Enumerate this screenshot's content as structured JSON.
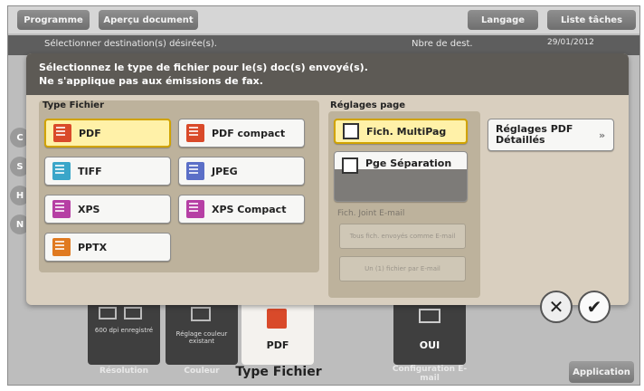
{
  "topbar": {
    "programme": "Programme",
    "apercu": "Aperçu document",
    "langage": "Langage",
    "liste_taches": "Liste tâches"
  },
  "destbar": {
    "text": "Sélectionner destination(s) désirée(s).",
    "nbre": "Nbre de dest.",
    "date": "29/01/2012"
  },
  "side_tabs": [
    "C",
    "S",
    "H",
    "N"
  ],
  "dialog": {
    "line1": "Sélectionnez le type de fichier pour le(s) doc(s) envoyé(s).",
    "line2": "Ne s'applique pas aux émissions de fax.",
    "type_fichier_title": "Type Fichier",
    "file_types": [
      {
        "label": "PDF",
        "icon": "pdf-icon",
        "color": "#d94a2a",
        "selected": true
      },
      {
        "label": "PDF compact",
        "icon": "pdf-compact-icon",
        "color": "#d94a2a",
        "selected": false
      },
      {
        "label": "TIFF",
        "icon": "tiff-icon",
        "color": "#3aa6c9",
        "selected": false
      },
      {
        "label": "JPEG",
        "icon": "jpeg-icon",
        "color": "#5b6fc7",
        "selected": false
      },
      {
        "label": "XPS",
        "icon": "xps-icon",
        "color": "#b63fa4",
        "selected": false
      },
      {
        "label": "XPS Compact",
        "icon": "xps-compact-icon",
        "color": "#b63fa4",
        "selected": false
      },
      {
        "label": "PPTX",
        "icon": "pptx-icon",
        "color": "#e07a20",
        "selected": false
      }
    ],
    "reglages_page_title": "Réglages page",
    "page_options": [
      {
        "label": "Fich. MultiPag",
        "selected": true
      },
      {
        "label": "Pge Séparation",
        "selected": false
      }
    ],
    "fich_joint_label": "Fich. Joint E-mail",
    "email_btn1": "Tous fich. envoyés comme E-mail",
    "email_btn2": "Un (1) fichier par E-mail",
    "reglages_pdf": "Réglages PDF Détaillés",
    "reglages_pdf_arrow": "»"
  },
  "actions": {
    "cancel_glyph": "✕",
    "ok_glyph": "✔"
  },
  "bottom": {
    "resolution_label": "Résolution",
    "resolution_tile_text": "600 dpi enregistré",
    "couleur_label": "Couleur",
    "couleur_tile_text": "Réglage couleur existant",
    "type_fichier_value": "PDF",
    "type_fichier_label": "Type Fichier",
    "config_value": "OUI",
    "config_label": "Configuration E-mail",
    "application": "Application"
  }
}
